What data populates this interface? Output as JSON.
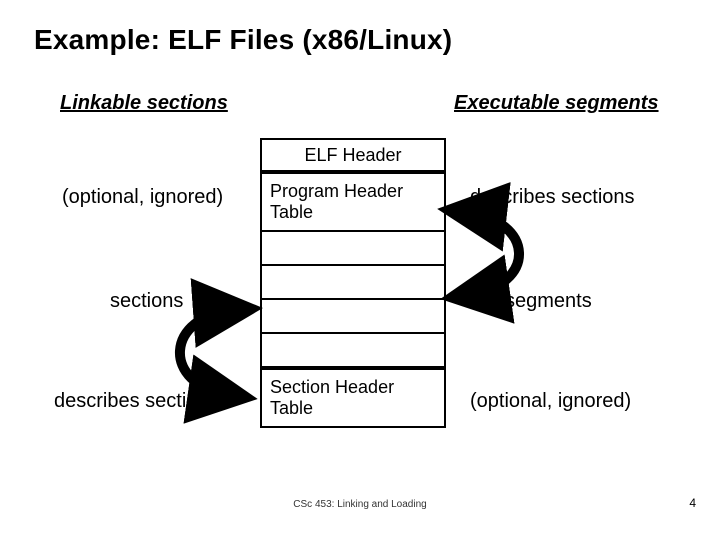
{
  "title": "Example: ELF Files (x86/Linux)",
  "left_column_heading": "Linkable sections",
  "right_column_heading": "Executable segments",
  "boxes": {
    "elf_header": "ELF Header",
    "program_header_table": "Program Header Table",
    "section_header_table": "Section Header Table"
  },
  "left_annotations": {
    "program_header": "(optional, ignored)",
    "middle_rows": "sections",
    "section_header": "describes sections"
  },
  "right_annotations": {
    "program_header": "describes sections",
    "middle_rows": "segments",
    "section_header": "(optional, ignored)"
  },
  "footer": {
    "course": "CSc 453: Linking and Loading",
    "page": "4"
  }
}
